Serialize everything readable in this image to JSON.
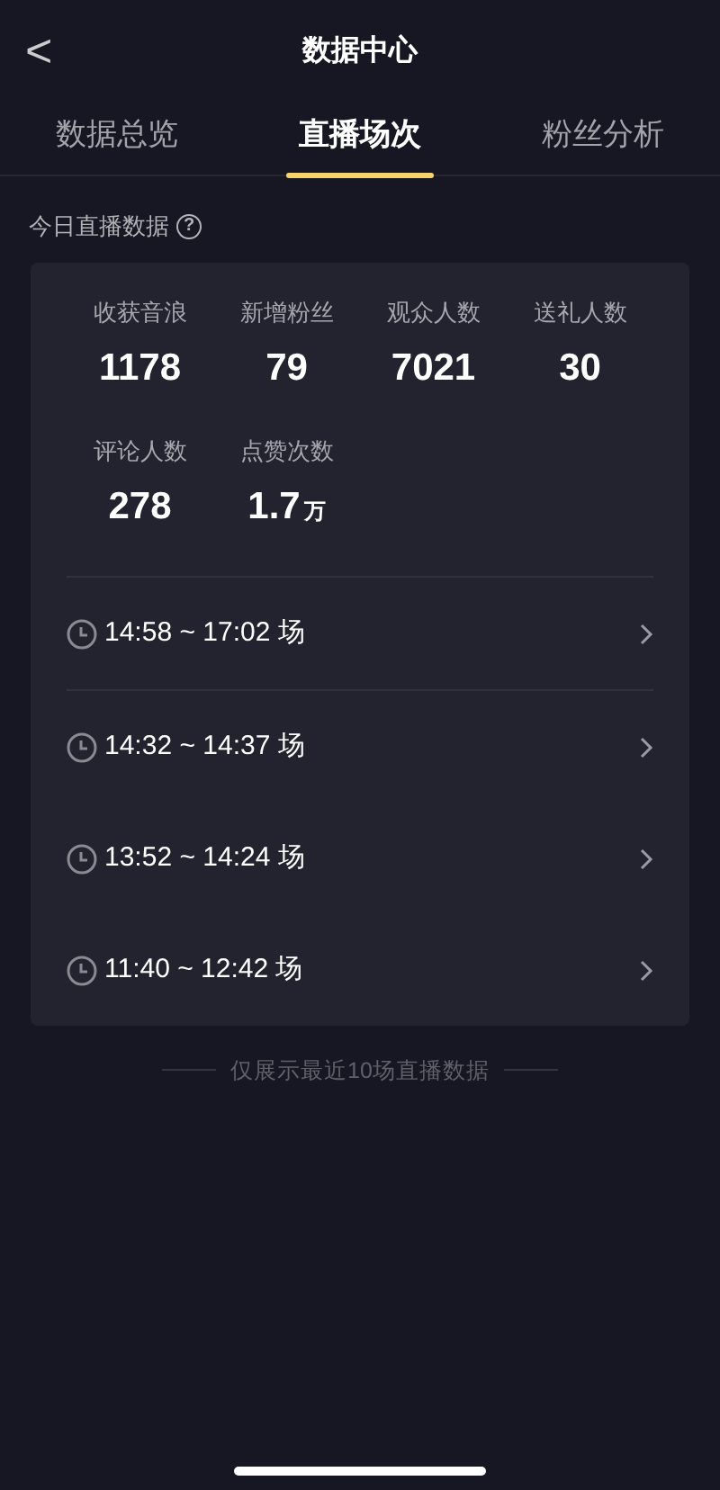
{
  "header": {
    "back": "<",
    "title": "数据中心"
  },
  "tabs": [
    {
      "label": "数据总览",
      "selected": false
    },
    {
      "label": "直播场次",
      "selected": true
    },
    {
      "label": "粉丝分析",
      "selected": false
    }
  ],
  "section": {
    "title": "今日直播数据",
    "help": "?"
  },
  "stats": [
    {
      "label": "收获音浪",
      "value": "1178"
    },
    {
      "label": "新增粉丝",
      "value": "79"
    },
    {
      "label": "观众人数",
      "value": "7021"
    },
    {
      "label": "送礼人数",
      "value": "30"
    },
    {
      "label": "评论人数",
      "value": "278"
    },
    {
      "label": "点赞次数",
      "value": "1.7",
      "unit": "万"
    }
  ],
  "sessions": [
    {
      "time": "14:58 ~ 17:02 场"
    },
    {
      "time": "14:32 ~ 14:37 场"
    },
    {
      "time": "13:52 ~ 14:24 场"
    },
    {
      "time": "11:40 ~ 12:42 场"
    }
  ],
  "footer_note": "仅展示最近10场直播数据"
}
